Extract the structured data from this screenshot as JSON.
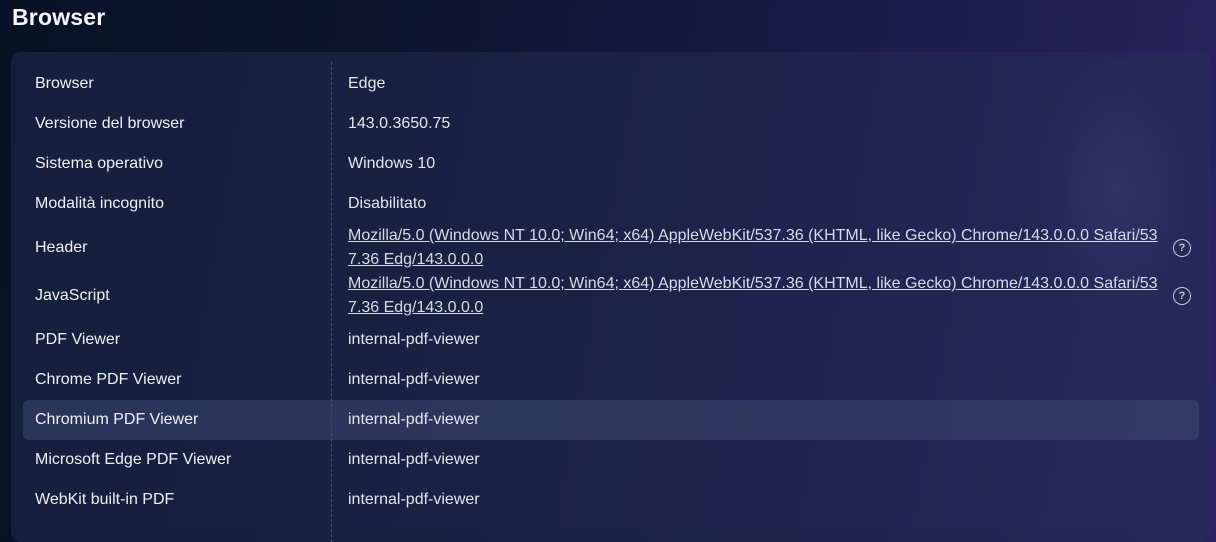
{
  "page": {
    "title": "Browser"
  },
  "rows": [
    {
      "label": "Browser",
      "value": "Edge"
    },
    {
      "label": "Versione del browser",
      "value": "143.0.3650.75"
    },
    {
      "label": "Sistema operativo",
      "value": "Windows 10"
    },
    {
      "label": "Modalità incognito",
      "value": "Disabilitato"
    },
    {
      "label": "Header",
      "value": "Mozilla/5.0 (Windows NT 10.0; Win64; x64) AppleWebKit/537.36 (KHTML, like Gecko) Chrome/143.0.0.0 Safari/537.36 Edg/143.0.0.0",
      "help_icon": "help-icon"
    },
    {
      "label": "JavaScript",
      "value": "Mozilla/5.0 (Windows NT 10.0; Win64; x64) AppleWebKit/537.36 (KHTML, like Gecko) Chrome/143.0.0.0 Safari/537.36 Edg/143.0.0.0",
      "help_icon": "help-icon"
    },
    {
      "label": "PDF Viewer",
      "value": "internal-pdf-viewer"
    },
    {
      "label": "Chrome PDF Viewer",
      "value": "internal-pdf-viewer"
    },
    {
      "label": "Chromium PDF Viewer",
      "value": "internal-pdf-viewer"
    },
    {
      "label": "Microsoft Edge PDF Viewer",
      "value": "internal-pdf-viewer"
    },
    {
      "label": "WebKit built-in PDF",
      "value": "internal-pdf-viewer"
    }
  ],
  "help_icon_glyph": "?",
  "colors": {
    "panel": "#263056",
    "highlight_row": "#3c4870",
    "text": "#eef0f6"
  }
}
